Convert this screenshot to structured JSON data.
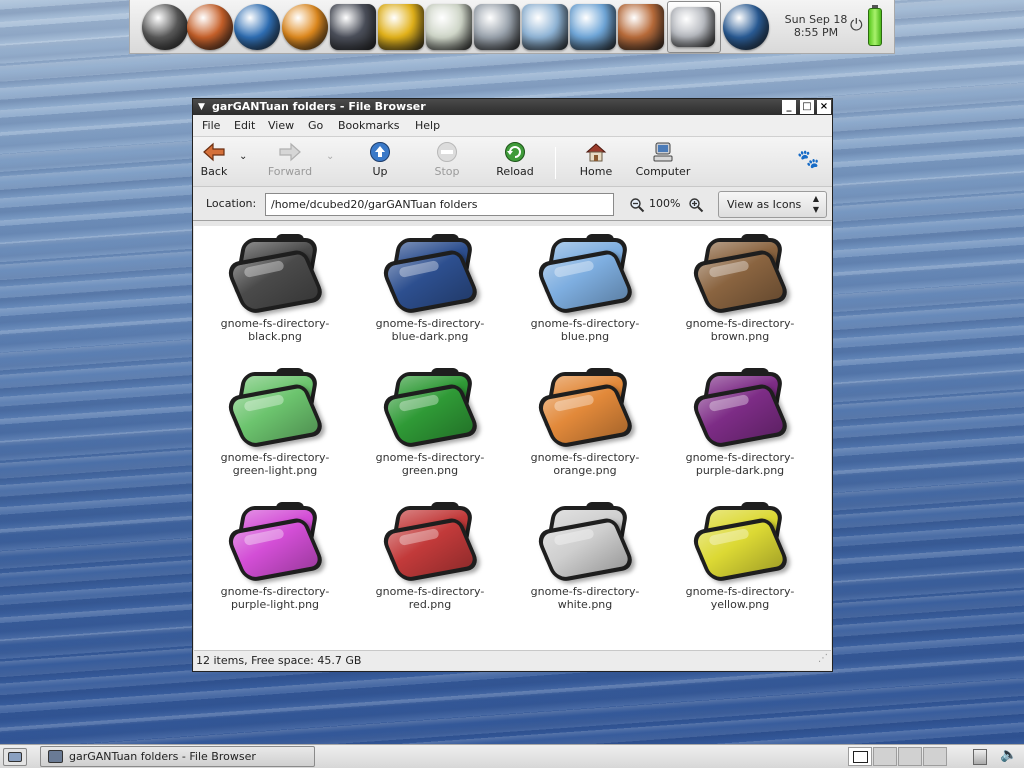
{
  "dock": {
    "launchers": [
      {
        "name": "gnome-foot-icon",
        "color": "#5a5a5a"
      },
      {
        "name": "firefox-icon",
        "color": "#c8612a"
      },
      {
        "name": "globe-icon",
        "color": "#2f6fb5"
      },
      {
        "name": "screaming-face-icon",
        "color": "#e08a1e"
      },
      {
        "name": "media-player-icon",
        "color": "#4b4f5a"
      },
      {
        "name": "lightning-icon",
        "color": "#e2b21a"
      },
      {
        "name": "quill-icon",
        "color": "#cfd6c8"
      },
      {
        "name": "calculator-icon",
        "color": "#9aa3ad"
      },
      {
        "name": "mail-icon",
        "color": "#8fb4d6"
      },
      {
        "name": "monitor-icon",
        "color": "#6fa6d8"
      },
      {
        "name": "home-icon",
        "color": "#b86b3a"
      },
      {
        "name": "drive-icon",
        "color": "#b9bcc2"
      },
      {
        "name": "trash-icon",
        "color": "#2a5c96"
      }
    ],
    "clock_date": "Sun Sep 18",
    "clock_time": "8:55 PM"
  },
  "window": {
    "title": "garGANTuan folders - File Browser",
    "menu": [
      "File",
      "Edit",
      "View",
      "Go",
      "Bookmarks",
      "Help"
    ],
    "toolbar": {
      "back": "Back",
      "forward": "Forward",
      "up": "Up",
      "stop": "Stop",
      "reload": "Reload",
      "home": "Home",
      "computer": "Computer"
    },
    "location_label": "Location:",
    "location_value": "/home/dcubed20/garGANTuan folders",
    "zoom_level": "100%",
    "view_mode": "View as Icons",
    "files": [
      {
        "line1": "gnome-fs-directory-",
        "line2": "black.png",
        "color": "#4a4a4a"
      },
      {
        "line1": "gnome-fs-directory-",
        "line2": "blue-dark.png",
        "color": "#2d4f8f"
      },
      {
        "line1": "gnome-fs-directory-",
        "line2": "blue.png",
        "color": "#7eaee0"
      },
      {
        "line1": "gnome-fs-directory-",
        "line2": "brown.png",
        "color": "#8a6440"
      },
      {
        "line1": "gnome-fs-directory-",
        "line2": "green-light.png",
        "color": "#6cc46e"
      },
      {
        "line1": "gnome-fs-directory-",
        "line2": "green.png",
        "color": "#2f9a36"
      },
      {
        "line1": "gnome-fs-directory-",
        "line2": "orange.png",
        "color": "#e2893a"
      },
      {
        "line1": "gnome-fs-directory-",
        "line2": "purple-dark.png",
        "color": "#7d2c86"
      },
      {
        "line1": "gnome-fs-directory-",
        "line2": "purple-light.png",
        "color": "#d34ed6"
      },
      {
        "line1": "gnome-fs-directory-",
        "line2": "red.png",
        "color": "#c23a3a"
      },
      {
        "line1": "gnome-fs-directory-",
        "line2": "white.png",
        "color": "#cfcfcf"
      },
      {
        "line1": "gnome-fs-directory-",
        "line2": "yellow.png",
        "color": "#dcd934"
      }
    ],
    "status": "12 items, Free space: 45.7 GB"
  },
  "panel": {
    "task_title": "garGANTuan folders - File Browser"
  }
}
